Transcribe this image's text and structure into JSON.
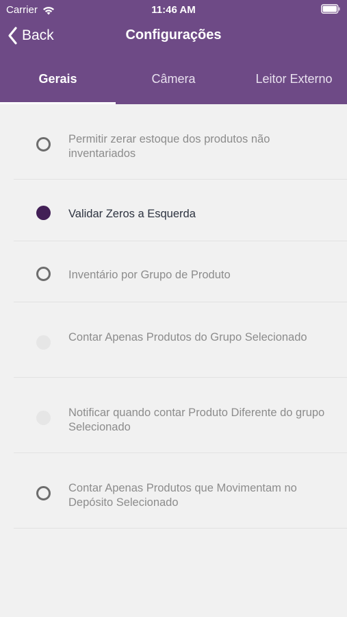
{
  "status_bar": {
    "carrier": "Carrier",
    "time": "11:46 AM"
  },
  "nav": {
    "back_label": "Back",
    "title": "Configurações"
  },
  "tabs": [
    {
      "label": "Gerais",
      "active": true
    },
    {
      "label": "Câmera",
      "active": false
    },
    {
      "label": "Leitor Externo",
      "active": false
    }
  ],
  "options": [
    {
      "label": "Permitir zerar estoque dos produtos não inventariados",
      "state": "unchecked"
    },
    {
      "label": "Validar Zeros a Esquerda",
      "state": "checked"
    },
    {
      "label": "Inventário por Grupo de Produto",
      "state": "unchecked"
    },
    {
      "label": "Contar Apenas Produtos do Grupo Selecionado",
      "state": "disabled"
    },
    {
      "label": "Notificar quando contar Produto Diferente do grupo Selecionado",
      "state": "disabled"
    },
    {
      "label": "Contar Apenas Produtos que Movimentam no Depósito Selecionado",
      "state": "unchecked"
    }
  ],
  "colors": {
    "header": "#6e4a86",
    "radio_checked": "#421f56",
    "background": "#f1f1f1"
  },
  "icons": {
    "wifi": "wifi-icon",
    "battery": "battery-icon",
    "back": "chevron-left-icon"
  }
}
